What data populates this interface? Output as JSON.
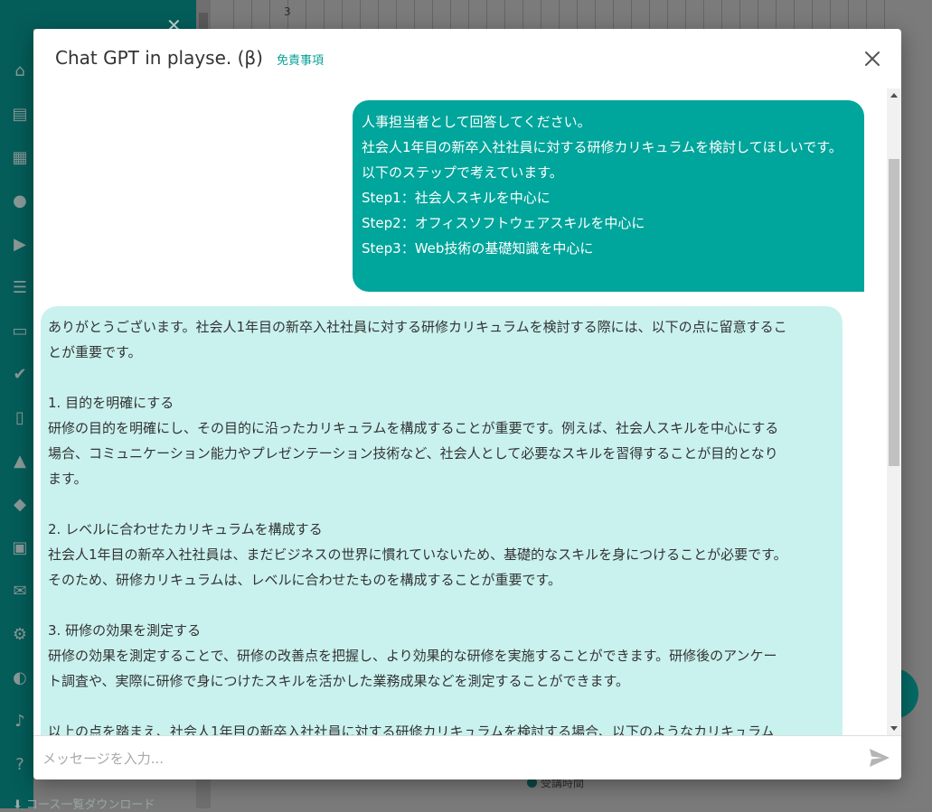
{
  "background": {
    "chart_tick": "3",
    "legend_label": "受講時間",
    "download_label": "コース一覧ダウンロード"
  },
  "modal": {
    "title": "Chat GPT in playse. (β)",
    "disclaimer_link": "免責事項",
    "user_message": [
      "人事担当者として回答してください。",
      "社会人1年目の新卒入社社員に対する研修カリキュラムを検討してほしいです。",
      "以下のステップで考えています。",
      "Step1：社会人スキルを中心に",
      "Step2：オフィスソフトウェアスキルを中心に",
      "Step3：Web技術の基礎知識を中心に"
    ],
    "assistant_message": [
      "ありがとうございます。社会人1年目の新卒入社社員に対する研修カリキュラムを検討する際には、以下の点に留意するこ",
      "とが重要です。",
      "",
      "1. 目的を明確にする",
      "研修の目的を明確にし、その目的に沿ったカリキュラムを構成することが重要です。例えば、社会人スキルを中心にする",
      "場合、コミュニケーション能力やプレゼンテーション技術など、社会人として必要なスキルを習得することが目的となり",
      "ます。",
      "",
      "2. レベルに合わせたカリキュラムを構成する",
      "社会人1年目の新卒入社社員は、まだビジネスの世界に慣れていないため、基礎的なスキルを身につけることが必要です。",
      "そのため、研修カリキュラムは、レベルに合わせたものを構成することが重要です。",
      "",
      "3. 研修の効果を測定する",
      "研修の効果を測定することで、研修の改善点を把握し、より効果的な研修を実施することができます。研修後のアンケー",
      "ト調査や、実際に研修で身につけたスキルを活かした業務成果などを測定することができます。",
      "",
      "以上の点を踏まえ、社会人1年目の新卒入社社員に対する研修カリキュラムを検討する場合、以下のようなカリキュラム"
    ],
    "input_placeholder": "メッセージを入力..."
  },
  "colors": {
    "sidebar": "#045d59",
    "user_bubble": "#00a59b",
    "assistant_bubble": "#c9f2ef",
    "link": "#0aa198"
  },
  "icons": {
    "sidebar": [
      "home-icon",
      "chat-icon",
      "building-icon",
      "people-icon",
      "video-library-icon",
      "list-icon",
      "book-icon",
      "assignment-check-icon",
      "door-icon",
      "shapes-icon",
      "tag-icon",
      "clipboard-icon",
      "mail-icon",
      "gear-icon",
      "palette-icon",
      "bell-icon",
      "help-icon",
      "download-icon"
    ],
    "modal": [
      "close-icon",
      "send-icon"
    ]
  }
}
